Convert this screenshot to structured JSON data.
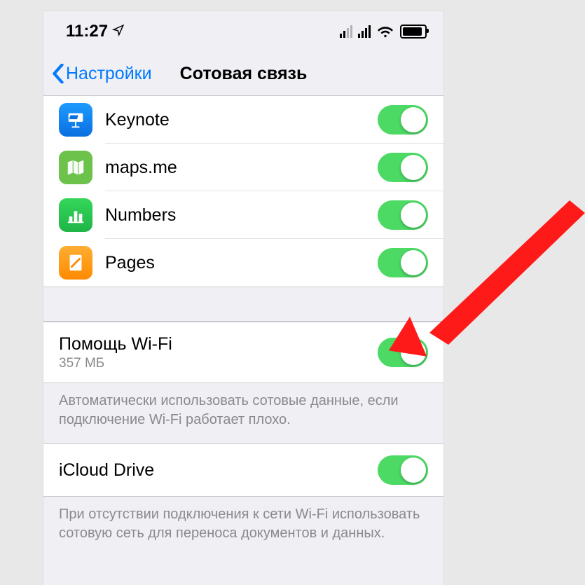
{
  "statusbar": {
    "time": "11:27"
  },
  "nav": {
    "back": "Настройки",
    "title": "Сотовая связь"
  },
  "apps": [
    {
      "name": "Keynote"
    },
    {
      "name": "maps.me"
    },
    {
      "name": "Numbers"
    },
    {
      "name": "Pages"
    }
  ],
  "wifi_assist": {
    "title": "Помощь Wi-Fi",
    "subtitle": "357 МБ",
    "footer": "Автоматически использовать сотовые данные, если подключение Wi-Fi работает плохо."
  },
  "icloud": {
    "title": "iCloud Drive",
    "footer": "При отсутствии подключения к сети Wi-Fi использовать сотовую сеть для переноса документов и данных."
  }
}
